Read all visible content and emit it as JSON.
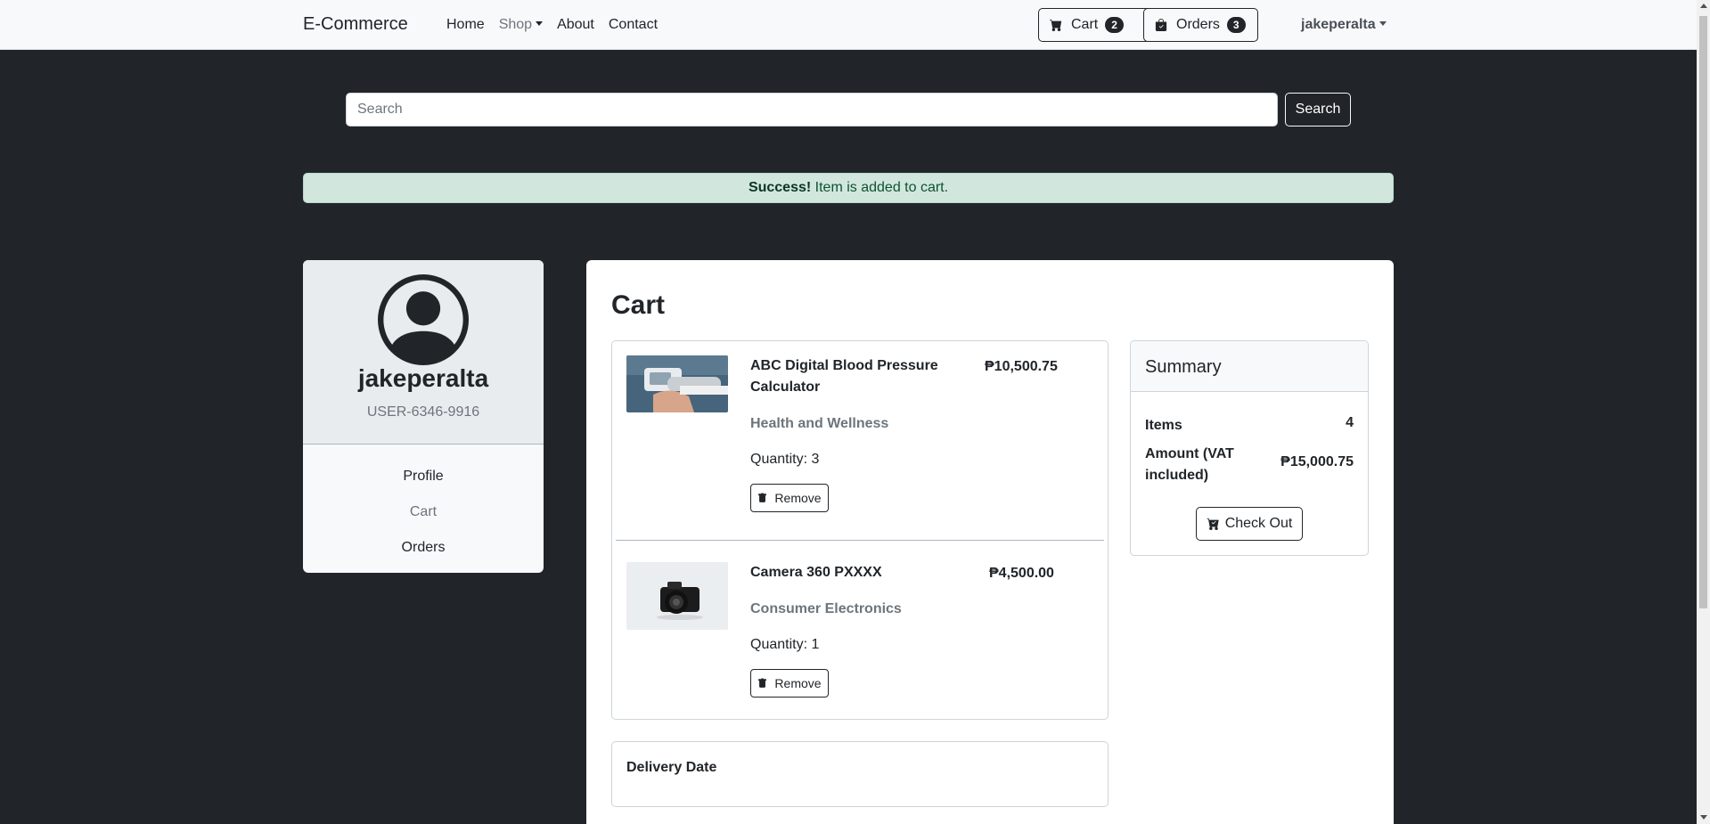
{
  "navbar": {
    "brand": "E-Commerce",
    "links": [
      {
        "label": "Home"
      },
      {
        "label": "Shop"
      },
      {
        "label": "About"
      },
      {
        "label": "Contact"
      }
    ],
    "cart_label": "Cart",
    "cart_count": "2",
    "orders_label": "Orders",
    "orders_count": "3",
    "user_menu": "jakeperalta"
  },
  "search": {
    "placeholder": "Search",
    "value": "",
    "button_label": "Search"
  },
  "alert": {
    "strong": "Success!",
    "message": "Item is added to cart."
  },
  "sidebar": {
    "username": "jakeperalta",
    "user_id": "USER-6346-9916",
    "links": [
      {
        "label": "Profile"
      },
      {
        "label": "Cart"
      },
      {
        "label": "Orders"
      }
    ]
  },
  "cart": {
    "title": "Cart",
    "items": [
      {
        "name": "ABC Digital Blood Pressure Calculator",
        "price": "₱10,500.75",
        "category": "Health and Wellness",
        "quantity": "Quantity: 3",
        "remove_label": "Remove"
      },
      {
        "name": "Camera 360 PXXXX",
        "price": "₱4,500.00",
        "category": "Consumer Electronics",
        "quantity": "Quantity: 1",
        "remove_label": "Remove"
      }
    ],
    "delivery_label": "Delivery Date"
  },
  "summary": {
    "title": "Summary",
    "items_label": "Items",
    "items_value": "4",
    "amount_label": "Amount (VAT included)",
    "amount_value": "₱15,000.75",
    "checkout_label": "Check Out"
  },
  "colors": {
    "background": "#212529",
    "navbar": "#f8f9fa",
    "success_bg": "#d1e7dd",
    "success_text": "#0f5132"
  },
  "icons": {
    "cart": "cart-icon",
    "orders": "bag-icon",
    "avatar": "user-circle-icon",
    "remove": "trash-icon",
    "checkout": "cart-check-icon"
  }
}
